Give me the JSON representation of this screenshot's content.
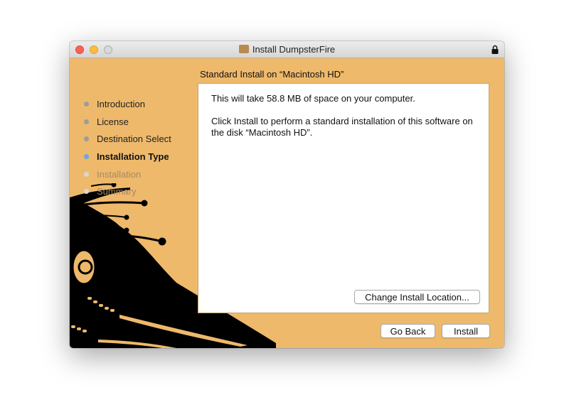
{
  "window": {
    "title": "Install DumpsterFire"
  },
  "heading": "Standard Install on “Macintosh HD”",
  "steps": [
    {
      "label": "Introduction",
      "state": "done"
    },
    {
      "label": "License",
      "state": "done"
    },
    {
      "label": "Destination Select",
      "state": "done"
    },
    {
      "label": "Installation Type",
      "state": "current"
    },
    {
      "label": "Installation",
      "state": "pending"
    },
    {
      "label": "Summary",
      "state": "pending"
    }
  ],
  "content": {
    "space_text": "This will take 58.8 MB of space on your computer.",
    "instructions": "Click Install to perform a standard installation of this software on the disk “Macintosh HD”.",
    "change_location_label": "Change Install Location..."
  },
  "buttons": {
    "back": "Go Back",
    "install": "Install"
  },
  "colors": {
    "background": "#eeb96b",
    "current_step": "#6aa6e8"
  }
}
